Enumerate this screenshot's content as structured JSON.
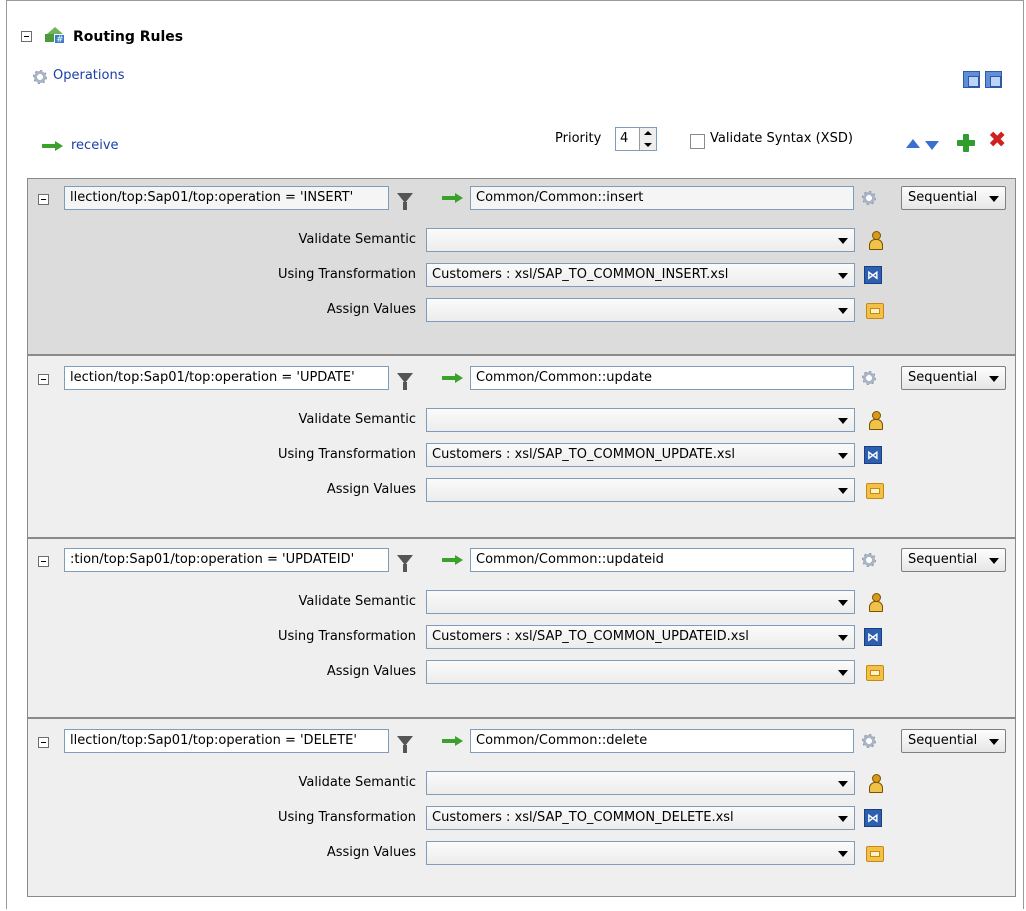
{
  "header": {
    "title": "Routing Rules",
    "operations_label": "Operations"
  },
  "toolbar": {
    "receive_label": "receive",
    "priority_label": "Priority",
    "priority_value": "4",
    "validate_syntax_label": "Validate Syntax (XSD)"
  },
  "rules": [
    {
      "expression": "llection/top:Sap01/top:operation = 'INSERT'",
      "target": "Common/Common::insert",
      "mode": "Sequential",
      "validate_label": "Validate Semantic",
      "validate_value": "",
      "transform_label": "Using Transformation",
      "transform_value": "Customers : xsl/SAP_TO_COMMON_INSERT.xsl",
      "assign_label": "Assign Values",
      "assign_value": ""
    },
    {
      "expression": "lection/top:Sap01/top:operation = 'UPDATE'",
      "target": "Common/Common::update",
      "mode": "Sequential",
      "validate_label": "Validate Semantic",
      "validate_value": "",
      "transform_label": "Using Transformation",
      "transform_value": "Customers : xsl/SAP_TO_COMMON_UPDATE.xsl",
      "assign_label": "Assign Values",
      "assign_value": ""
    },
    {
      "expression": ":tion/top:Sap01/top:operation = 'UPDATEID'",
      "target": "Common/Common::updateid",
      "mode": "Sequential",
      "validate_label": "Validate Semantic",
      "validate_value": "",
      "transform_label": "Using Transformation",
      "transform_value": "Customers : xsl/SAP_TO_COMMON_UPDATEID.xsl",
      "assign_label": "Assign Values",
      "assign_value": ""
    },
    {
      "expression": "llection/top:Sap01/top:operation = 'DELETE'",
      "target": "Common/Common::delete",
      "mode": "Sequential",
      "validate_label": "Validate Semantic",
      "validate_value": "",
      "transform_label": "Using Transformation",
      "transform_value": "Customers : xsl/SAP_TO_COMMON_DELETE.xsl",
      "assign_label": "Assign Values",
      "assign_value": ""
    }
  ]
}
